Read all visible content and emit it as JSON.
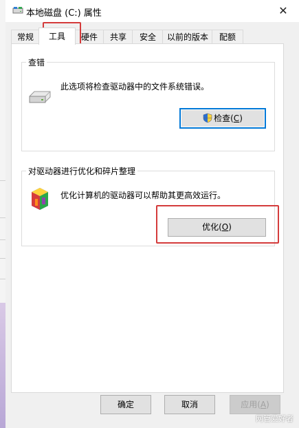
{
  "window": {
    "title": "本地磁盘 (C:) 属性",
    "close_glyph": "✕"
  },
  "tabs": [
    {
      "label": "常规"
    },
    {
      "label": "工具"
    },
    {
      "label": "硬件"
    },
    {
      "label": "共享"
    },
    {
      "label": "安全"
    },
    {
      "label": "以前的版本"
    },
    {
      "label": "配额"
    }
  ],
  "active_tab": "工具",
  "error_check": {
    "title": "查错",
    "description": "此选项将检查驱动器中的文件系统错误。",
    "button": {
      "label": "检查(C)",
      "text": "检查(",
      "accesskey": "C",
      "close": ")"
    }
  },
  "optimize": {
    "title": "对驱动器进行优化和碎片整理",
    "description": "优化计算机的驱动器可以帮助其更高效运行。",
    "button": {
      "label": "优化(O)",
      "text": "优化(",
      "accesskey": "O",
      "close": ")"
    }
  },
  "footer": {
    "ok": "确定",
    "cancel": "取消",
    "apply": {
      "text": "应用(",
      "accesskey": "A",
      "close": ")"
    }
  },
  "watermark": "网管爱好者"
}
